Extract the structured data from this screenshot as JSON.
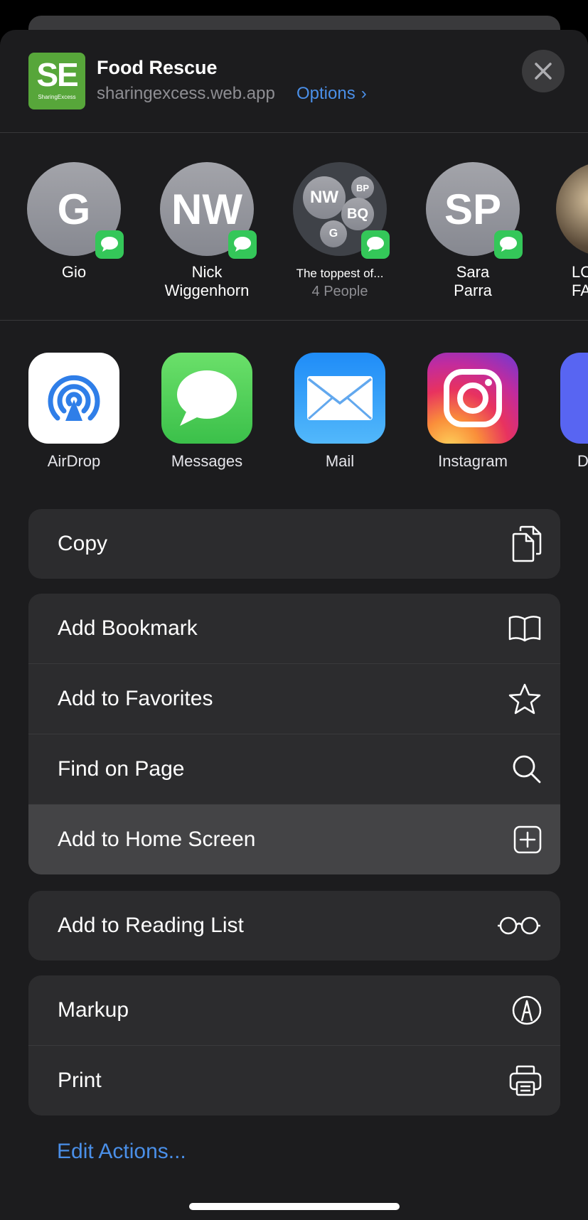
{
  "header": {
    "icon_text": "SE",
    "icon_subtext": "SharingExcess",
    "title": "Food Rescue",
    "url": "sharingexcess.web.app",
    "options_label": "Options",
    "options_chevron": "›"
  },
  "contacts": [
    {
      "initials": "G",
      "name": "Gio"
    },
    {
      "initials": "NW",
      "name": "Nick\nWiggenhorn"
    },
    {
      "group_initials": [
        "NW",
        "BP",
        "BQ",
        "G"
      ],
      "name": "The toppest of...",
      "sub": "4 People"
    },
    {
      "initials": "SP",
      "name": "Sara\nParra"
    },
    {
      "name": "LO\nFA"
    }
  ],
  "apps": [
    {
      "label": "AirDrop",
      "icon": "airdrop-icon"
    },
    {
      "label": "Messages",
      "icon": "messages-icon"
    },
    {
      "label": "Mail",
      "icon": "mail-icon"
    },
    {
      "label": "Instagram",
      "icon": "instagram-icon"
    },
    {
      "label": "D",
      "icon": "discord-icon"
    }
  ],
  "actions": {
    "copy": "Copy",
    "add_bookmark": "Add Bookmark",
    "add_favorites": "Add to Favorites",
    "find_on_page": "Find on Page",
    "add_home_screen": "Add to Home Screen",
    "add_reading_list": "Add to Reading List",
    "markup": "Markup",
    "print": "Print"
  },
  "edit_actions": "Edit Actions...",
  "colors": {
    "accent": "#4a8fe8",
    "sheet_bg": "#1c1c1e",
    "row_bg": "#2c2c2e",
    "highlight_bg": "#444446",
    "messages_green": "#34c759",
    "brand_green": "#57a63a"
  }
}
